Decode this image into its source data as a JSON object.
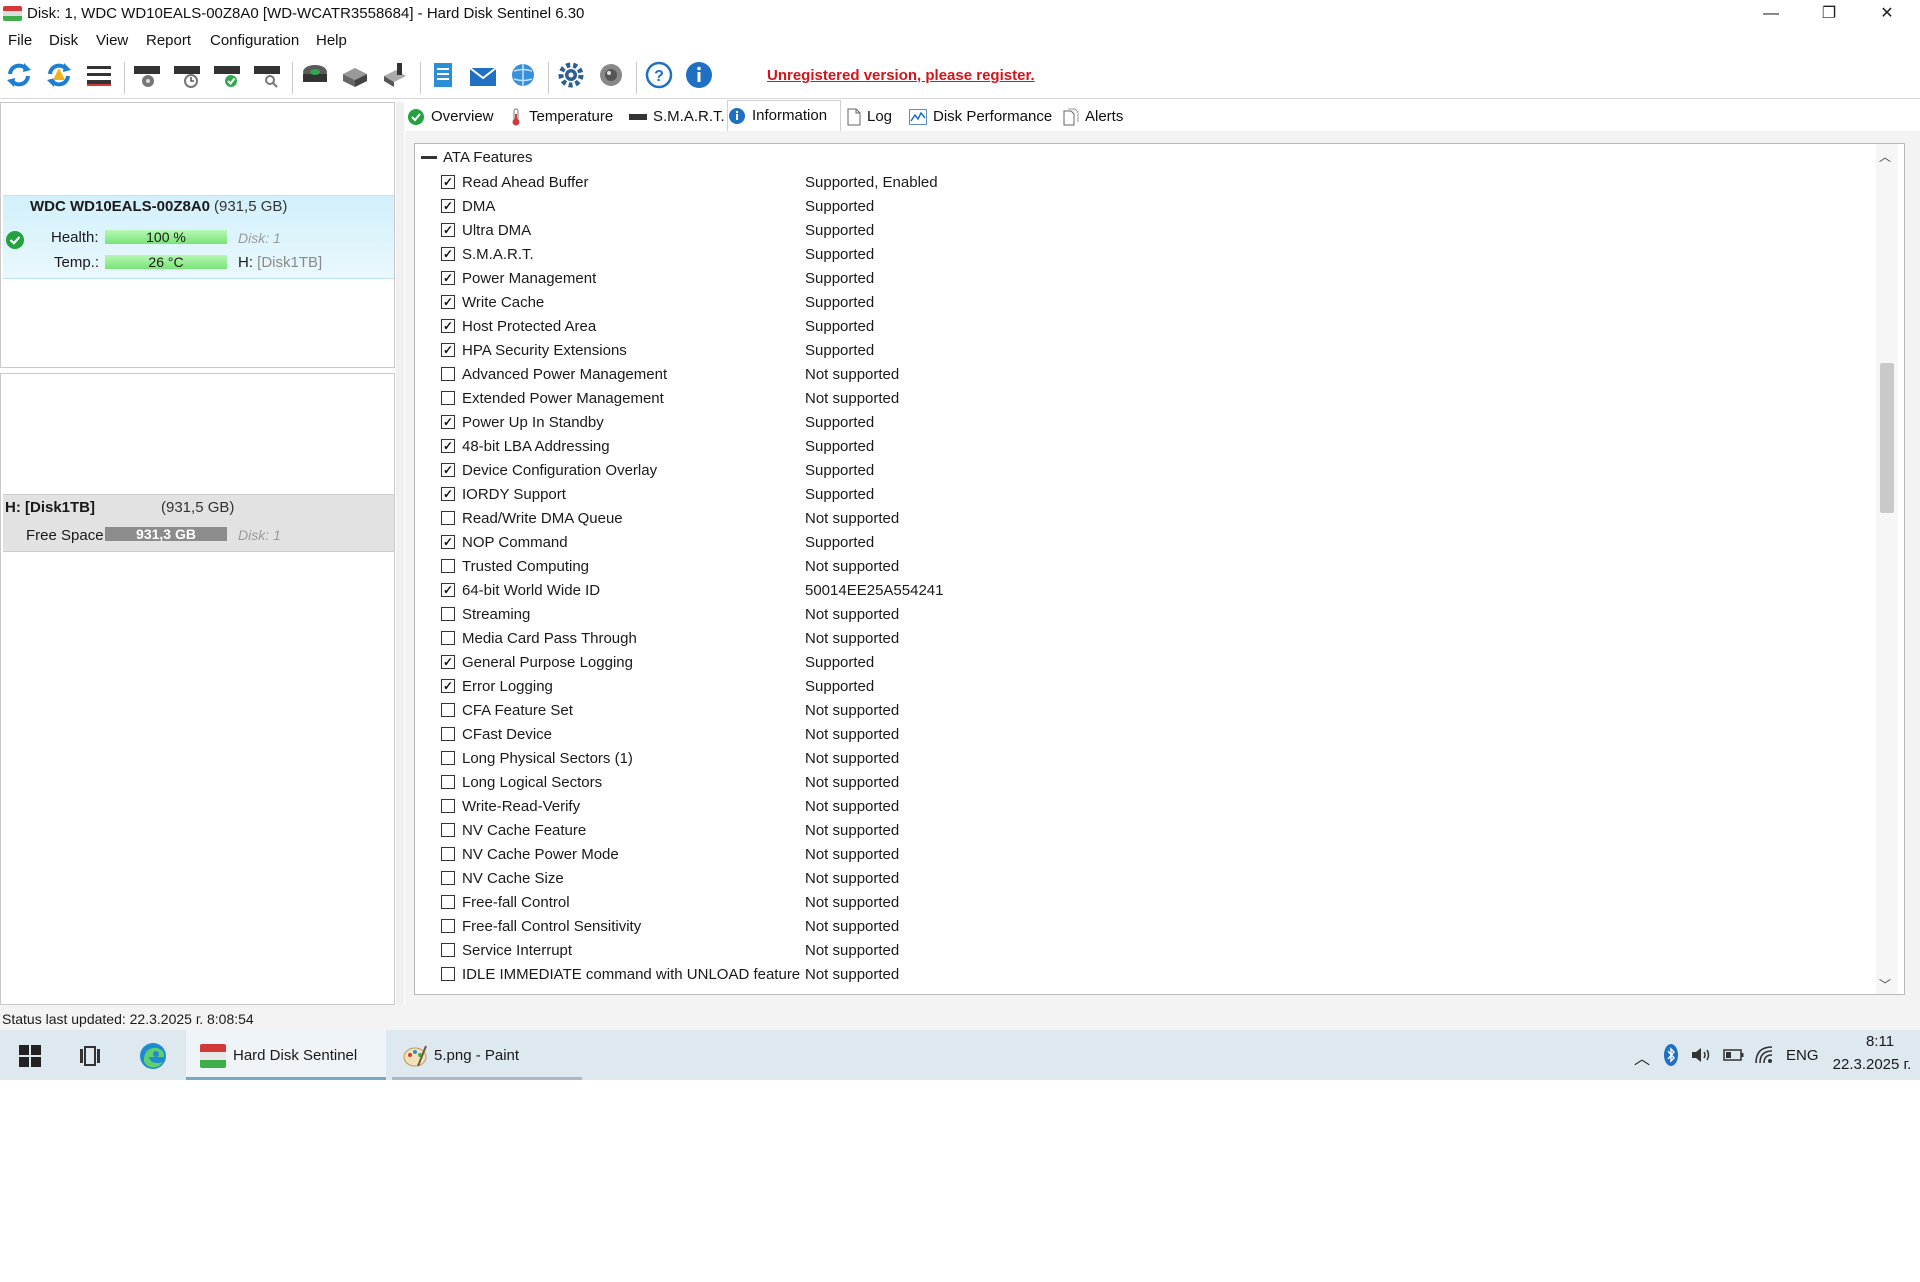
{
  "window": {
    "title": "Disk: 1, WDC WD10EALS-00Z8A0 [WD-WCATR3558684]  -  Hard Disk Sentinel 6.30",
    "minimize": "—",
    "restore": "❐",
    "close": "✕"
  },
  "menu": [
    "File",
    "Disk",
    "View",
    "Report",
    "Configuration",
    "Help"
  ],
  "toolbar": {
    "register_text": "Unregistered version, please register."
  },
  "disk": {
    "name": "WDC WD10EALS-00Z8A0",
    "size": "(931,5 GB)",
    "health_label": "Health:",
    "health_value": "100 %",
    "health_percent": 100,
    "health_disk": "Disk: 1",
    "temp_label": "Temp.:",
    "temp_value": "26 °C",
    "temp_drive_prefix": "H:",
    "temp_drive_name": "[Disk1TB]"
  },
  "partition": {
    "name": "H: [Disk1TB]",
    "size": "(931,5 GB)",
    "free_label": "Free Space",
    "free_value": "931,3 GB",
    "disk": "Disk: 1"
  },
  "tabs": [
    {
      "label": "Overview",
      "icon": "check-circle-icon",
      "active": false
    },
    {
      "label": "Temperature",
      "icon": "thermometer-icon",
      "active": false
    },
    {
      "label": "S.M.A.R.T.",
      "icon": "drive-icon",
      "active": false
    },
    {
      "label": "Information",
      "icon": "info-icon",
      "active": true
    },
    {
      "label": "Log",
      "icon": "document-icon",
      "active": false
    },
    {
      "label": "Disk Performance",
      "icon": "chart-icon",
      "active": false
    },
    {
      "label": "Alerts",
      "icon": "alerts-icon",
      "active": false
    }
  ],
  "group": {
    "title": "ATA Features"
  },
  "features": [
    {
      "name": "Read Ahead Buffer",
      "checked": true,
      "value": "Supported, Enabled"
    },
    {
      "name": "DMA",
      "checked": true,
      "value": "Supported"
    },
    {
      "name": "Ultra DMA",
      "checked": true,
      "value": "Supported"
    },
    {
      "name": "S.M.A.R.T.",
      "checked": true,
      "value": "Supported"
    },
    {
      "name": "Power Management",
      "checked": true,
      "value": "Supported"
    },
    {
      "name": "Write Cache",
      "checked": true,
      "value": "Supported"
    },
    {
      "name": "Host Protected Area",
      "checked": true,
      "value": "Supported"
    },
    {
      "name": "HPA Security Extensions",
      "checked": true,
      "value": "Supported"
    },
    {
      "name": "Advanced Power Management",
      "checked": false,
      "value": "Not supported"
    },
    {
      "name": "Extended Power Management",
      "checked": false,
      "value": "Not supported"
    },
    {
      "name": "Power Up In Standby",
      "checked": true,
      "value": "Supported"
    },
    {
      "name": "48-bit LBA Addressing",
      "checked": true,
      "value": "Supported"
    },
    {
      "name": "Device Configuration Overlay",
      "checked": true,
      "value": "Supported"
    },
    {
      "name": "IORDY Support",
      "checked": true,
      "value": "Supported"
    },
    {
      "name": "Read/Write DMA Queue",
      "checked": false,
      "value": "Not supported"
    },
    {
      "name": "NOP Command",
      "checked": true,
      "value": "Supported"
    },
    {
      "name": "Trusted Computing",
      "checked": false,
      "value": "Not supported"
    },
    {
      "name": "64-bit World Wide ID",
      "checked": true,
      "value": "50014EE25A554241"
    },
    {
      "name": "Streaming",
      "checked": false,
      "value": "Not supported"
    },
    {
      "name": "Media Card Pass Through",
      "checked": false,
      "value": "Not supported"
    },
    {
      "name": "General Purpose Logging",
      "checked": true,
      "value": "Supported"
    },
    {
      "name": "Error Logging",
      "checked": true,
      "value": "Supported"
    },
    {
      "name": "CFA Feature Set",
      "checked": false,
      "value": "Not supported"
    },
    {
      "name": "CFast Device",
      "checked": false,
      "value": "Not supported"
    },
    {
      "name": "Long Physical Sectors (1)",
      "checked": false,
      "value": "Not supported"
    },
    {
      "name": "Long Logical Sectors",
      "checked": false,
      "value": "Not supported"
    },
    {
      "name": "Write-Read-Verify",
      "checked": false,
      "value": "Not supported"
    },
    {
      "name": "NV Cache Feature",
      "checked": false,
      "value": "Not supported"
    },
    {
      "name": "NV Cache Power Mode",
      "checked": false,
      "value": "Not supported"
    },
    {
      "name": "NV Cache Size",
      "checked": false,
      "value": "Not supported"
    },
    {
      "name": "Free-fall Control",
      "checked": false,
      "value": "Not supported"
    },
    {
      "name": "Free-fall Control Sensitivity",
      "checked": false,
      "value": "Not supported"
    },
    {
      "name": "Service Interrupt",
      "checked": false,
      "value": "Not supported"
    },
    {
      "name": "IDLE IMMEDIATE command with UNLOAD feature",
      "checked": false,
      "value": "Not supported"
    }
  ],
  "status": {
    "text": "Status last updated: 22.3.2025 г. 8:08:54"
  },
  "taskbar": {
    "apps": [
      {
        "label": "Hard Disk Sentinel",
        "icon": "hdsentinel-icon",
        "active": true
      },
      {
        "label": "5.png - Paint",
        "icon": "paint-icon",
        "active": false
      }
    ],
    "lang": "ENG",
    "time": "8:11",
    "date": "22.3.2025 г."
  },
  "colors": {
    "accent_red": "#d4141b",
    "health_green": "#78e477",
    "selection_blue": "#d2f0fb",
    "taskbar": "#dde8ef"
  }
}
